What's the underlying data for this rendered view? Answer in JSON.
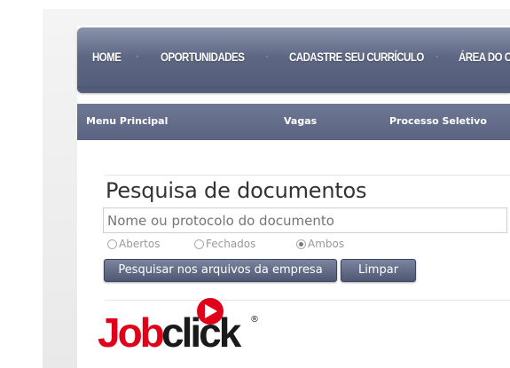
{
  "top_nav": {
    "items": [
      "HOME",
      "OPORTUNIDADES",
      "CADASTRE SEU CURRÍCULO",
      "ÁREA DO C"
    ],
    "separator": "·"
  },
  "sub_nav": {
    "items": [
      "Menu Principal",
      "Vagas",
      "Processo Seletivo"
    ]
  },
  "search": {
    "title": "Pesquisa de documentos",
    "placeholder": "Nome ou protocolo do documento",
    "filters": [
      {
        "label": "Abertos",
        "checked": false
      },
      {
        "label": "Fechados",
        "checked": false
      },
      {
        "label": "Ambos",
        "checked": true
      }
    ],
    "search_button": "Pesquisar nos arquivos da empresa",
    "clear_button": "Limpar"
  },
  "logo": {
    "text_dark": "Job",
    "text_light": "click",
    "registered": "®"
  },
  "colors": {
    "nav_bg": "#5d6784",
    "logo_red": "#e0001a",
    "logo_dark": "#1a1a1a"
  }
}
